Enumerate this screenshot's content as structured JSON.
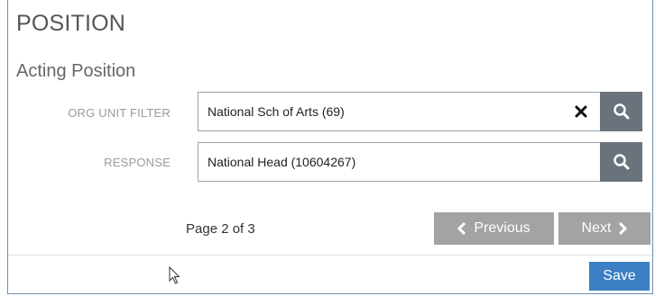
{
  "header": {
    "title": "POSITION"
  },
  "section": {
    "title": "Acting Position"
  },
  "fields": {
    "org_unit_filter": {
      "label": "ORG UNIT FILTER",
      "value": "National Sch of Arts (69)"
    },
    "response": {
      "label": "RESPONSE",
      "value": "National Head (10604267)"
    }
  },
  "icons": {
    "clear": "close-icon",
    "search": "search-icon",
    "previous": "chevron-left-icon",
    "next": "chevron-right-icon",
    "cursor": "mouse-pointer-icon"
  },
  "pagination": {
    "indicator": "Page 2 of 3",
    "previous_label": "Previous",
    "next_label": "Next"
  },
  "footer": {
    "save_label": "Save"
  },
  "colors": {
    "search_button": "#6a737b",
    "pager_button": "#a3a3a3",
    "save_button": "#3b7fc4",
    "frame_border": "#6e8fb0"
  }
}
